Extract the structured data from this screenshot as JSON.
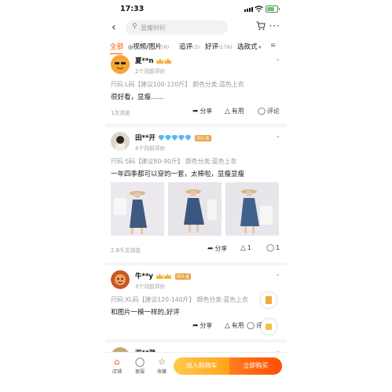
{
  "status_bar": {
    "time": "17:33"
  },
  "header": {
    "search_placeholder": "显瘦衬衫"
  },
  "tabs": [
    {
      "label": "全部",
      "count": ""
    },
    {
      "label": "视频/图片",
      "count": "(6)"
    },
    {
      "label": "追评",
      "count": "(3)"
    },
    {
      "label": "好评",
      "count": "(176)"
    },
    {
      "label": "选款式",
      "count": ""
    }
  ],
  "reviews": [
    {
      "user": "夏**n",
      "date": "2个月前评价",
      "tag": "",
      "spec": "尺码:L码【建议100-120斤】 颜色分类:蓝色上衣",
      "text": "很好看，显瘦......",
      "views": "1次浏览",
      "share": "分享",
      "useful": "有用",
      "useful_count": "",
      "comment": "评论",
      "comment_count": ""
    },
    {
      "user": "田**开",
      "date": "4个月前评价",
      "tag": "回头客",
      "spec": "尺码:S码【建议80-90斤】 颜色分类:蓝色上衣",
      "text": "一年四季都可以穿的一套，太棒啦，显瘦显瘦",
      "views": "2.8千次浏览",
      "share": "分享",
      "useful": "",
      "useful_count": "1",
      "comment": "",
      "comment_count": "1"
    },
    {
      "user": "牛**y",
      "date": "3个月前评价",
      "tag": "回头客",
      "spec": "尺码:XL码【建议120-140斤】 颜色分类:蓝色上衣",
      "text": "和图片一模一样的,好评",
      "views": "",
      "share": "分享",
      "useful": "有用",
      "useful_count": "",
      "comment": "评论",
      "comment_count": ""
    },
    {
      "user": "双**游",
      "date": "",
      "tag": "",
      "spec": "",
      "text": "",
      "views": "",
      "share": "",
      "useful": "",
      "useful_count": "",
      "comment": "",
      "comment_count": ""
    }
  ],
  "bottom_bar": {
    "shop": "店铺",
    "service": "客服",
    "favorite": "收藏",
    "add_to_cart": "加入购物车",
    "buy_now": "立即购买"
  },
  "colors": {
    "accent": "#ff5000",
    "badge": "#f4b23e",
    "tag": "#e7a23c"
  }
}
